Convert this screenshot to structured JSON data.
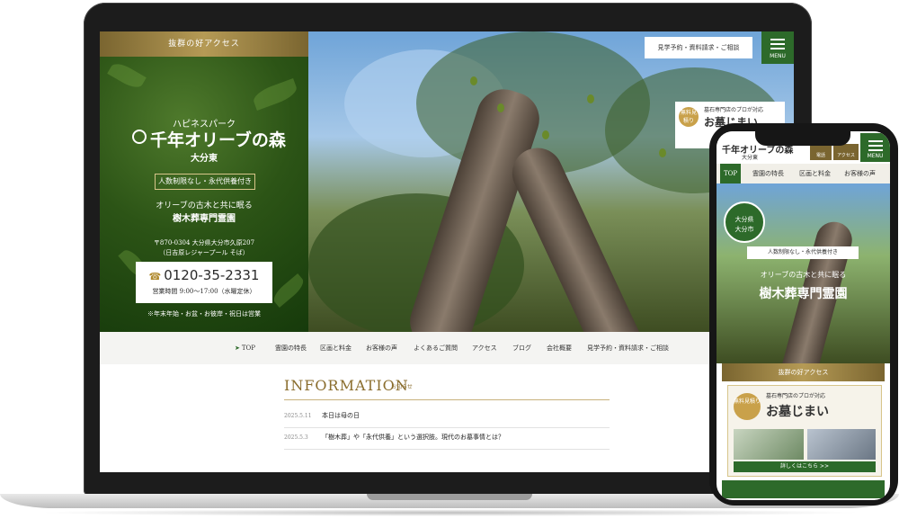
{
  "laptop": {
    "left_panel": {
      "access_label": "抜群の好アクセス",
      "subtitle": "ハピネスパーク",
      "logo": "千年オリーブの森",
      "area": "大分東",
      "badge": "人数制限なし・永代供養付き",
      "tagline1": "オリーブの古木と共に眠る",
      "tagline2": "樹木葬専門霊園",
      "address1": "〒870-0304 大分県大分市久原207",
      "address2": "（日吉原レジャープール そば）",
      "tel": "0120-35-2331",
      "hours": "営業時間 9:00〜17:00（水曜定休）",
      "holiday_note": "※年末年始・お盆・お彼岸・祝日は営業"
    },
    "hero": {
      "cta": "見学予約・資料請求・ご相談",
      "menu_label": "MENU",
      "banner_badge": "無料見積り",
      "banner_text1": "墓石専門店のプロが対応",
      "banner_text2": "お墓じまい"
    },
    "nav": [
      "TOP",
      "霊園の特長",
      "区画と料金",
      "お客様の声",
      "よくあるご質問",
      "アクセス",
      "ブログ",
      "会社概要",
      "見学予約・資料請求・ご相談"
    ],
    "information": {
      "title": "INFORMATION",
      "subtitle": "お知らせ",
      "items": [
        {
          "date": "2025.5.11",
          "text": "本日は母の日"
        },
        {
          "date": "2025.5.3",
          "text": "「樹木葬」や「永代供養」という選択肢。現代のお墓事情とは？"
        }
      ]
    }
  },
  "phone": {
    "logo": "千年オリーブの森",
    "area": "大分東",
    "tel_label": "電話",
    "access_label": "アクセス",
    "menu_label": "MENU",
    "tabs": [
      "TOP",
      "霊園の特長",
      "区画と料金",
      "お客様の声"
    ],
    "circle": [
      "大分県",
      "大分市"
    ],
    "badge": "人数制限なし・永代供養付き",
    "tagline1": "オリーブの古木と共に眠る",
    "tagline2": "樹木葬専門霊園",
    "access_bar": "抜群の好アクセス",
    "banner": {
      "badge": "無料見積り",
      "text1": "墓石専門店のプロが対応",
      "text2": "お墓じまい",
      "more": "詳しくはこちら >>"
    }
  },
  "colors": {
    "green": "#2d6a2a",
    "gold": "#b59a55"
  }
}
